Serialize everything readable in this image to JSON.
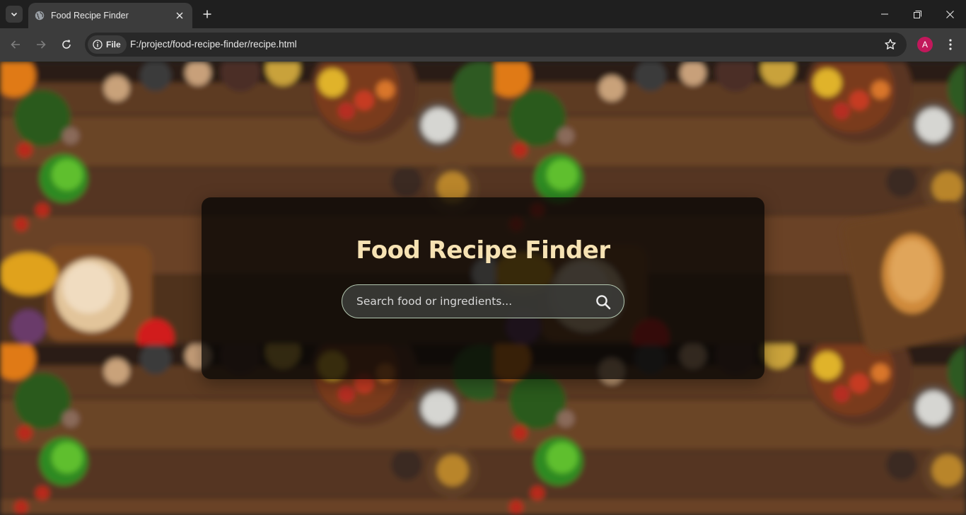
{
  "browser": {
    "tab_title": "Food Recipe Finder",
    "site_chip_label": "File",
    "url": "F:/project/food-recipe-finder/recipe.html",
    "profile_initial": "A",
    "profile_color": "#c2185b"
  },
  "page": {
    "title": "Food Recipe Finder",
    "search_placeholder": "Search food or ingredients...",
    "search_icon": "magnifier-icon",
    "title_color": "#f6e2b3",
    "background": "blurred wooden table with bowls of vegetables, peppers, tomatoes, bread and herbs"
  }
}
